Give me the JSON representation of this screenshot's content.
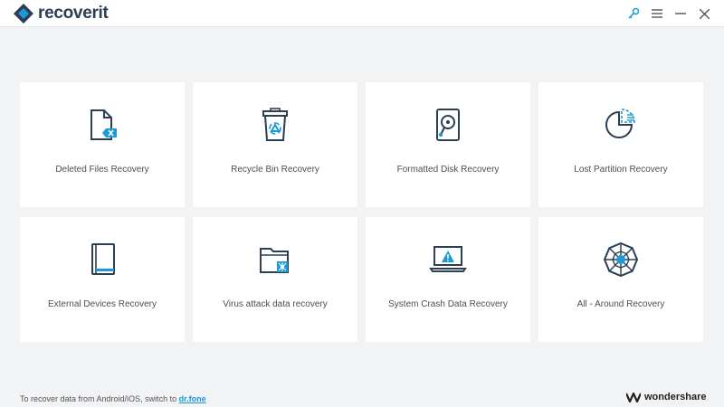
{
  "app": {
    "brand": "recoverit",
    "colors": {
      "accent": "#1c9ad6",
      "dark": "#2b3e52"
    }
  },
  "titlebar": {
    "icons": [
      "key-icon",
      "menu-icon",
      "minimize-icon",
      "close-icon"
    ]
  },
  "cards": [
    {
      "label": "Deleted Files Recovery",
      "icon": "deleted-file-icon"
    },
    {
      "label": "Recycle Bin Recovery",
      "icon": "recycle-bin-icon"
    },
    {
      "label": "Formatted Disk Recovery",
      "icon": "hard-disk-icon"
    },
    {
      "label": "Lost Partition Recovery",
      "icon": "partition-pie-icon"
    },
    {
      "label": "External Devices Recovery",
      "icon": "external-device-icon"
    },
    {
      "label": "Virus attack data recovery",
      "icon": "virus-folder-icon"
    },
    {
      "label": "System Crash Data Recovery",
      "icon": "laptop-warning-icon"
    },
    {
      "label": "All - Around Recovery",
      "icon": "web-network-icon"
    }
  ],
  "footer": {
    "prefix": "To recover data from Android/iOS, switch to ",
    "link": "dr.fone",
    "vendor": "wondershare"
  }
}
